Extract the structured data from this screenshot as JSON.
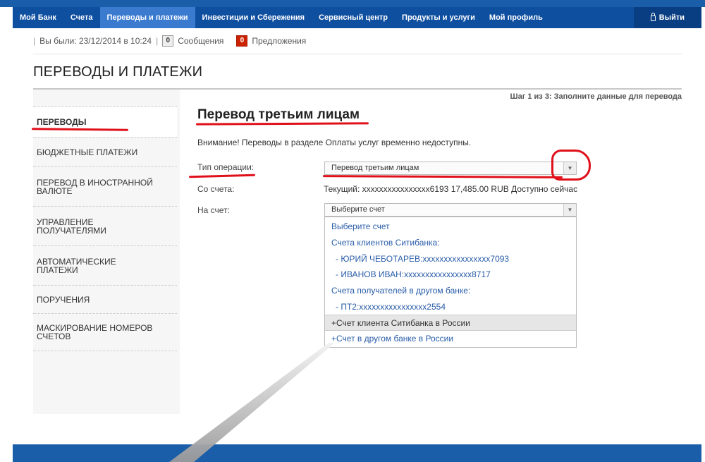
{
  "nav": {
    "items": [
      "Мой Банк",
      "Счета",
      "Переводы и платежи",
      "Инвестиции и Сбережения",
      "Сервисный центр",
      "Продукты и услуги",
      "Мой профиль"
    ],
    "active_index": 2,
    "logout": "Выйти"
  },
  "info": {
    "last_visit": "Вы были: 23/12/2014 в 10:24",
    "messages_count": "0",
    "messages_label": "Сообщения",
    "offers_count": "0",
    "offers_label": "Предложения"
  },
  "page_title": "ПЕРЕВОДЫ И ПЛАТЕЖИ",
  "sidebar": {
    "items": [
      {
        "label": "ПЕРЕВОДЫ"
      },
      {
        "label": "БЮДЖЕТНЫЕ ПЛАТЕЖИ"
      },
      {
        "label": "ПЕРЕВОД В ИНОСТРАННОЙ ВАЛЮТЕ"
      },
      {
        "label": "УПРАВЛЕНИЕ ПОЛУЧАТЕЛЯМИ"
      },
      {
        "label": "АВТОМАТИЧЕСКИЕ ПЛАТЕЖИ"
      },
      {
        "label": "ПОРУЧЕНИЯ"
      },
      {
        "label": "МАСКИРОВАНИЕ НОМЕРОВ СЧЕТОВ"
      }
    ]
  },
  "main": {
    "step": "Шаг 1 из 3: Заполните данные для перевода",
    "title": "Перевод третьим лицам",
    "warning": "Внимание! Переводы в разделе Оплаты услуг временно недоступны.",
    "operation_label": "Тип операции:",
    "operation_value": "Перевод третьим лицам",
    "from_label": "Со счета:",
    "from_value": "Текущий: xxxxxxxxxxxxxxxx6193 17,485.00 RUB Доступно сейчас",
    "to_label": "На счет:",
    "to_value": "Выберите счет"
  },
  "dropdown": {
    "options": [
      "Выберите счет",
      "Счета клиентов Ситибанка:",
      "- ЮРИЙ ЧЕБОТАРЕВ:xxxxxxxxxxxxxxxx7093",
      "- ИВАНОВ ИВАН:xxxxxxxxxxxxxxxx8717",
      "Счета получателей в другом банке:",
      "- ПТ2:xxxxxxxxxxxxxxxx2554",
      "+Счет клиента Ситибанка в России",
      "+Счет в другом банке в России"
    ]
  },
  "colors": {
    "nav_bg": "#0f4fa0",
    "nav_active": "#3a7bd0",
    "link": "#2a5da8",
    "annotation_red": "#e0101a"
  }
}
